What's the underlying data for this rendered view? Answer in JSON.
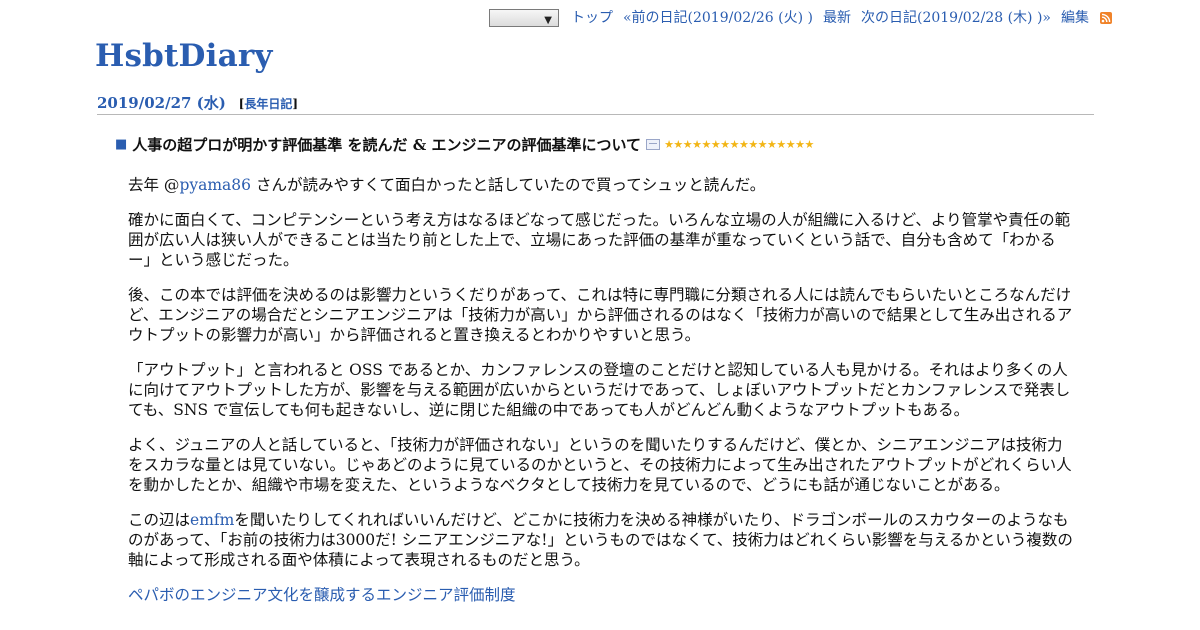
{
  "nav": {
    "select_value": "",
    "items": [
      {
        "label": "トップ"
      },
      {
        "label": "«前の日記(2019/02/26 (火) )"
      },
      {
        "label": "最新"
      },
      {
        "label": "次の日記(2019/02/28 (木) )»"
      },
      {
        "label": "編集"
      }
    ],
    "rss_icon": "rss-feed-icon"
  },
  "site": {
    "title": "HsbtDiary"
  },
  "day": {
    "date": "2019/02/27 (水)",
    "category_open": "[",
    "category": "長年日記",
    "category_close": "]"
  },
  "section": {
    "title": "人事の超プロが明かす評価基準 を読んだ & エンジニアの評価基準について",
    "stars": "★★★★★★★★★★★★★★★★"
  },
  "body": {
    "p1": {
      "pre": "去年 @",
      "link": "pyama86",
      "post": " さんが読みやすくて面白かったと話していたので買ってシュッと読んだ。"
    },
    "p2": "確かに面白くて、コンピテンシーという考え方はなるほどなって感じだった。いろんな立場の人が組織に入るけど、より管掌や責任の範囲が広い人は狭い人ができることは当たり前とした上で、立場にあった評価の基準が重なっていくという話で、自分も含めて「わかるー」という感じだった。",
    "p3": "後、この本では評価を決めるのは影響力というくだりがあって、これは特に専門職に分類される人には読んでもらいたいところなんだけど、エンジニアの場合だとシニアエンジニアは「技術力が高い」から評価されるのはなく「技術力が高いので結果として生み出されるアウトプットの影響力が高い」から評価されると置き換えるとわかりやすいと思う。",
    "p4": "「アウトプット」と言われると OSS であるとか、カンファレンスの登壇のことだけと認知している人も見かける。それはより多くの人に向けてアウトプットした方が、影響を与える範囲が広いからというだけであって、しょぼいアウトプットだとカンファレンスで発表しても、SNS で宣伝しても何も起きないし、逆に閉じた組織の中であっても人がどんどん動くようなアウトプットもある。",
    "p5": "よく、ジュニアの人と話していると、「技術力が評価されない」というのを聞いたりするんだけど、僕とか、シニアエンジニアは技術力をスカラな量とは見ていない。じゃあどのように見ているのかというと、その技術力によって生み出されたアウトプットがどれくらい人を動かしたとか、組織や市場を変えた、というようなベクタとして技術力を見ているので、どうにも話が通じないことがある。",
    "p6": {
      "pre": "この辺は",
      "link": "emfm",
      "post": "を聞いたりしてくれればいいんだけど、どこかに技術力を決める神様がいたり、ドラゴンボールのスカウターのようなものがあって、「お前の技術力は3000だ! シニアエンジニアな!」というものではなくて、技術力はどれくらい影響を与えるかという複数の軸によって形成される面や体積によって表現されるものだと思う。"
    },
    "p7_link": "ペパボのエンジニア文化を醸成するエンジニア評価制度"
  }
}
